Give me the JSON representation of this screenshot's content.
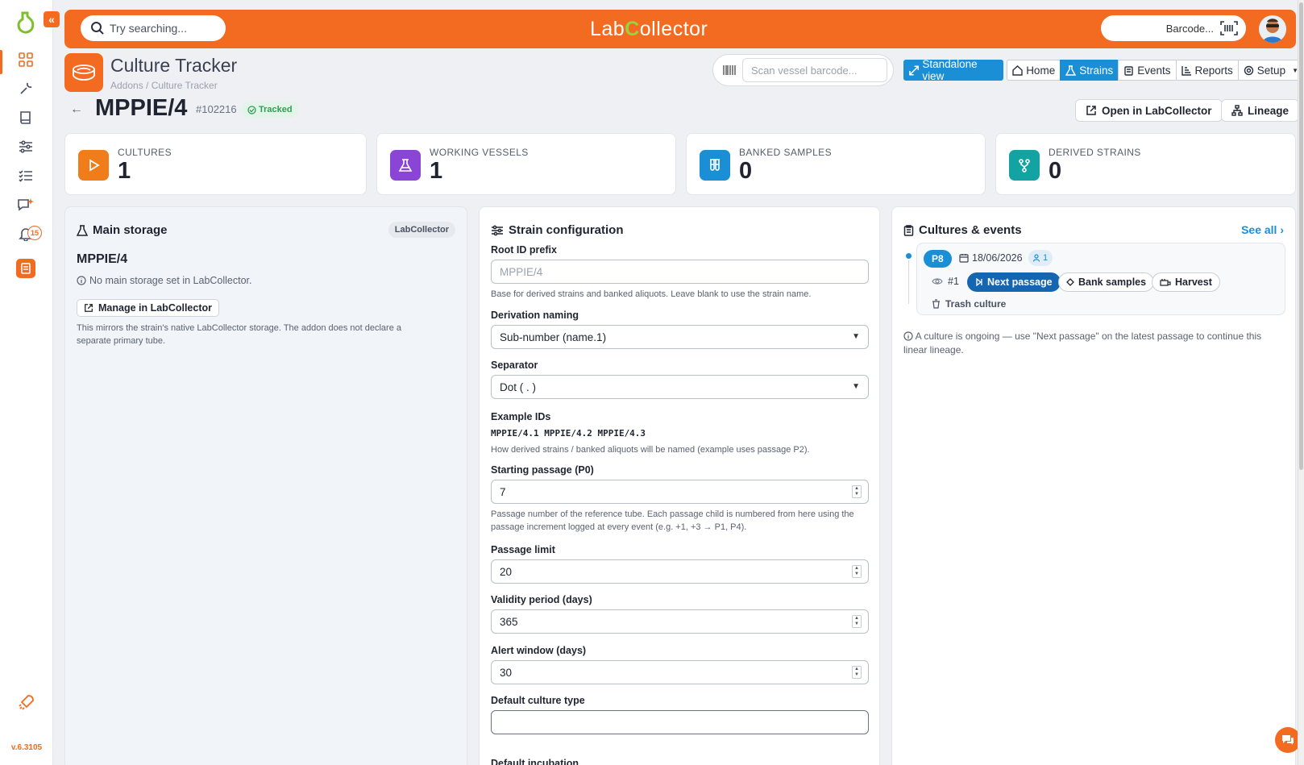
{
  "app": {
    "brand_left": "Lab",
    "brand_c": "C",
    "brand_right": "ollector",
    "version": "v.6.3105",
    "notification_count": "15"
  },
  "topbar": {
    "search_placeholder": "Try searching...",
    "barcode_placeholder": "Barcode..."
  },
  "header": {
    "app_title": "Culture Tracker",
    "breadcrumb": "Addons / Culture Tracker",
    "scan_placeholder": "Scan vessel barcode...",
    "standalone_label": "Standalone view",
    "nav": [
      "Home",
      "Strains",
      "Events",
      "Reports",
      "Setup"
    ],
    "active_nav": "Strains"
  },
  "strain": {
    "name": "MPPIE/4",
    "id": "#102216",
    "status": "Tracked",
    "open_button": "Open in LabCollector",
    "lineage_button": "Lineage"
  },
  "stats": [
    {
      "label": "CULTURES",
      "value": "1",
      "color": "#f07d1a"
    },
    {
      "label": "WORKING VESSELS",
      "value": "1",
      "color": "#8b45d6"
    },
    {
      "label": "BANKED SAMPLES",
      "value": "0",
      "color": "#1a8fd6"
    },
    {
      "label": "DERIVED STRAINS",
      "value": "0",
      "color": "#14a3a3"
    }
  ],
  "storage": {
    "title": "Main storage",
    "badge": "LabCollector",
    "strain_name": "MPPIE/4",
    "info": "No main storage set in LabCollector.",
    "manage_button": "Manage in LabCollector",
    "description": "This mirrors the strain's native LabCollector storage. The addon does not declare a separate primary tube."
  },
  "config": {
    "title": "Strain configuration",
    "root_label": "Root ID prefix",
    "root_placeholder": "MPPIE/4",
    "root_help": "Base for derived strains and banked aliquots. Leave blank to use the strain name.",
    "derivation_label": "Derivation naming",
    "derivation_value": "Sub-number (name.1)",
    "separator_label": "Separator",
    "separator_value": "Dot ( . )",
    "example_label": "Example IDs",
    "example_value": "MPPIE/4.1 MPPIE/4.2 MPPIE/4.3",
    "example_help": "How derived strains / banked aliquots will be named (example uses passage P2).",
    "start_label": "Starting passage (P0)",
    "start_value": "7",
    "start_help": "Passage number of the reference tube. Each passage child is numbered from here using the passage increment logged at every event (e.g. +1, +3 → P1, P4).",
    "limit_label": "Passage limit",
    "limit_value": "20",
    "validity_label": "Validity period (days)",
    "validity_value": "365",
    "alert_label": "Alert window (days)",
    "alert_value": "30",
    "culture_type_label": "Default culture type",
    "culture_type_value": "",
    "incubation_label": "Default incubation"
  },
  "events": {
    "title": "Cultures & events",
    "see_all": "See all ›",
    "passage": "P8",
    "date": "18/06/2026",
    "users": "1",
    "number": "#1",
    "next_passage": "Next passage",
    "bank_samples": "Bank samples",
    "harvest": "Harvest",
    "trash": "Trash culture",
    "note": "A culture is ongoing — use \"Next passage\" on the latest passage to continue this linear lineage."
  }
}
